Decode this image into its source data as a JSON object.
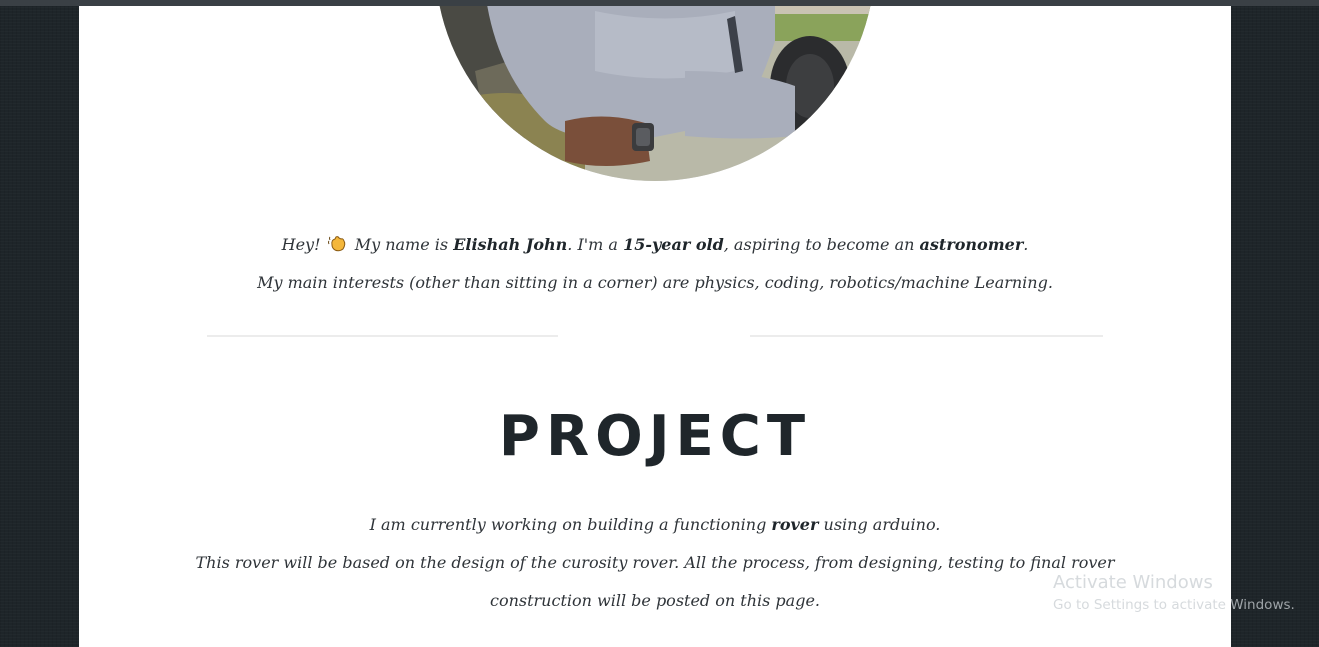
{
  "profile": {
    "photo_alt": "profile photo"
  },
  "intro": {
    "greeting": "Hey!",
    "emoji_name": "waving-hand-icon",
    "name_prefix": "My name is",
    "name": "Elishah John",
    "age_prefix": ". I'm a",
    "age": "15-year old",
    "goal_prefix": ", aspiring to become an",
    "goal": "astronomer",
    "goal_suffix": ".",
    "interests": "My main interests (other than sitting in a corner) are physics, coding, robotics/machine Learning."
  },
  "project": {
    "title": "PROJECT",
    "line1_prefix": "I am currently working on building a functioning",
    "line1_bold": "rover",
    "line1_suffix": "using arduino.",
    "line2": "This rover will be based on the design of the curosity rover. All the process, from designing, testing to final rover",
    "line3": "construction will be posted on this page."
  },
  "os_watermark": {
    "title": "Activate Windows",
    "subtitle": "Go to Settings to activate Windows."
  },
  "colors": {
    "background": "#1e2529",
    "page": "#ffffff",
    "text": "#2f3439",
    "heading": "#1f262b",
    "divider": "#ececec"
  }
}
